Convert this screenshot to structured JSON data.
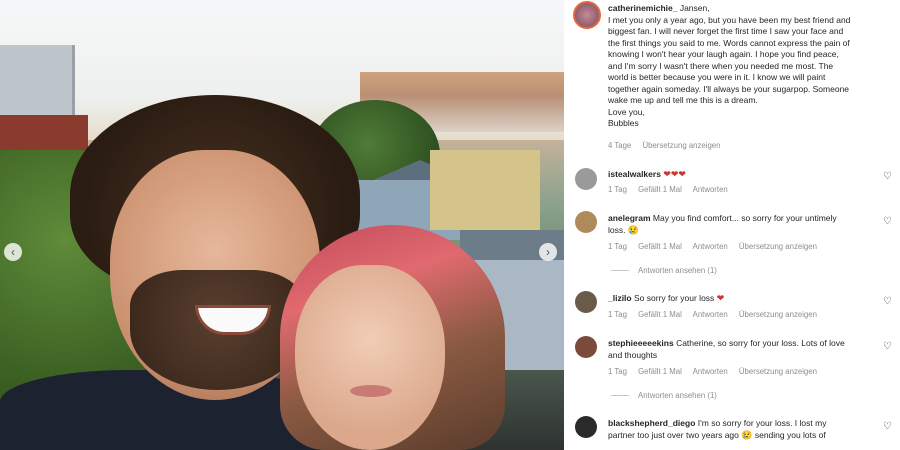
{
  "post": {
    "username": "catherinemichie_",
    "caption_lines": [
      "Jansen,",
      "I met you only a year ago, but you have been my best friend and",
      "biggest fan. I will never forget the first time I saw your face and",
      "the first things you said to me. Words cannot express the pain of",
      "knowing I won't hear your laugh again. I hope you find peace,",
      "and I'm sorry I wasn't there when you needed me most. The",
      "world is better because you were in it. I know we will paint",
      "together again someday. I'll always be your sugarpop. Someone",
      "wake me up and tell me this is a dream.",
      "Love you,",
      "Bubbles"
    ],
    "age": "4 Tage",
    "translate": "Übersetzung anzeigen"
  },
  "comments": [
    {
      "username": "istealwalkers",
      "text": "",
      "emoji": "❤❤❤",
      "meta": [
        "1 Tag",
        "Gefällt 1 Mal",
        "Antworten"
      ],
      "avatar_color": "#9a9a9a"
    },
    {
      "username": "anelegram",
      "text": "May you find comfort... so sorry for your untimely",
      "text2": "loss.",
      "emoji": "😢",
      "meta": [
        "1 Tag",
        "Gefällt 1 Mal",
        "Antworten",
        "Übersetzung anzeigen"
      ],
      "replies": "Antworten ansehen (1)",
      "avatar_color": "#b08a5a"
    },
    {
      "username": "_lizilo",
      "text": "So sorry for your loss",
      "emoji": "❤",
      "meta": [
        "1 Tag",
        "Gefällt 1 Mal",
        "Antworten",
        "Übersetzung anzeigen"
      ],
      "avatar_color": "#6a5a4a"
    },
    {
      "username": "stephieeeeekins",
      "text": "Catherine, so sorry for your loss. Lots of love",
      "text2": "and thoughts",
      "meta": [
        "1 Tag",
        "Gefällt 1 Mal",
        "Antworten",
        "Übersetzung anzeigen"
      ],
      "replies": "Antworten ansehen (1)",
      "avatar_color": "#7a4a3a"
    },
    {
      "username": "blackshepherd_diego",
      "text": "I'm so sorry for your loss. I lost my",
      "text2": "partner too just over two years ago",
      "text3": "sending you lots of",
      "emoji": "😢",
      "avatar_color": "#2a2a2a"
    }
  ],
  "nav": {
    "prev": "‹",
    "next": "›"
  },
  "icons": {
    "heart_outline": "♡"
  }
}
